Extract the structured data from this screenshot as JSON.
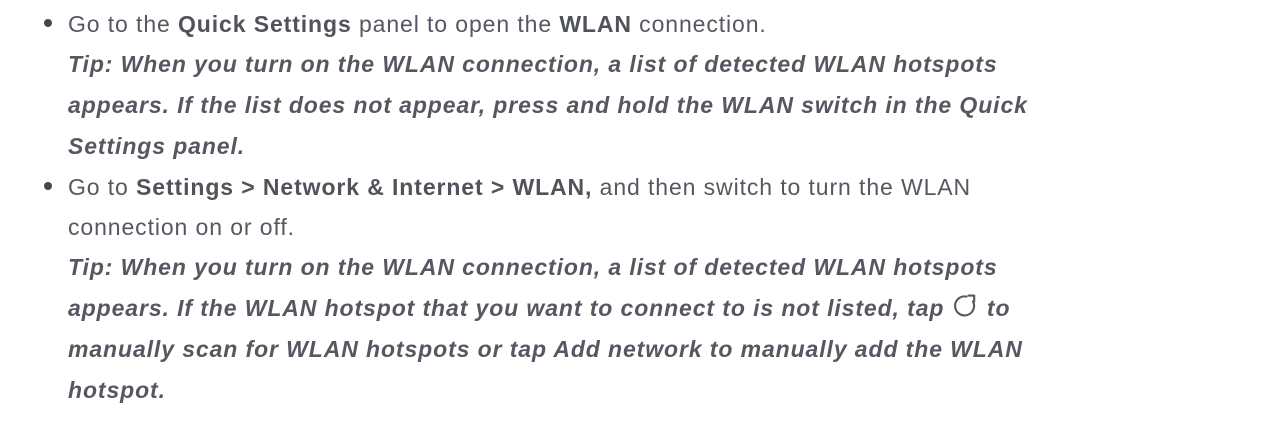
{
  "bullet1": {
    "t1": "Go to the ",
    "b1": "Quick Settings",
    "t2": " panel to open the ",
    "b2": "WLAN",
    "t3": " connection.",
    "tip_line1": "Tip: When you turn on the WLAN connection, a list of detected WLAN hotspots",
    "tip_line2": "appears. If the list does not appear, press and hold the WLAN switch in the Quick",
    "tip_line3": "Settings panel."
  },
  "bullet2": {
    "t1": "Go to ",
    "b1": "Settings > Network & Internet > WLAN,",
    "t2": " and then switch to turn the WLAN",
    "line2": "connection on or off.",
    "tip_line1": "Tip: When you turn on the WLAN connection, a list of detected WLAN hotspots",
    "tip_line2a": "appears. If the WLAN hotspot that you want to connect to is not listed, tap ",
    "tip_line2b": " to",
    "tip_line3": "manually scan for WLAN hotspots or tap Add network to manually add the WLAN",
    "tip_line4": "hotspot."
  },
  "icons": {
    "bullet": "bullet-dot",
    "refresh": "refresh-icon"
  },
  "colors": {
    "text": "#555860",
    "bullet": "#44474d"
  }
}
